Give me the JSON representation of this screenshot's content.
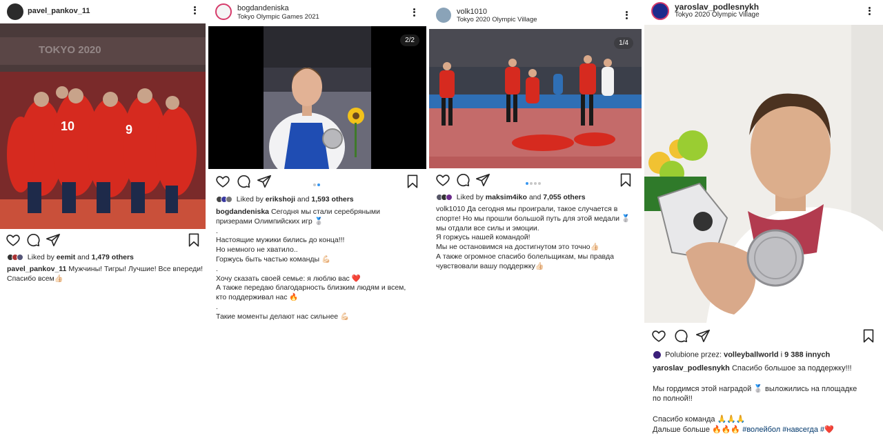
{
  "posts": [
    {
      "username": "pavel_pankov_11",
      "location": "",
      "photo": {
        "banner": "TOKYO 2020"
      },
      "liked_by": "eemit",
      "likes_count": "1,479 others",
      "caption_lines": [
        "Мужчины! Тигры! Лучшие! Все впереди!",
        "Спасибо всем👍🏻"
      ]
    },
    {
      "username": "bogdandeniska",
      "location": "Tokyo Olympic Games 2021",
      "counter": "2/2",
      "liked_by": "erikshoji",
      "likes_count": "1,593 others",
      "caption_lines": [
        "Сегодня мы стали серебряными",
        "призерами Олимпийских игр 🥈",
        ".",
        "Настоящие мужики бились до конца!!!",
        "Но немного не хватило..",
        "Горжусь быть частью команды 💪🏻",
        ".",
        "Хочу сказать своей семье: я люблю вас ❤️",
        "А также передаю благодарность близким людям и всем,",
        "кто поддерживал нас 🔥",
        ".",
        "Такие моменты делают нас сильнее 💪🏻"
      ]
    },
    {
      "username": "volk1010",
      "location": "Tokyo 2020 Olympic Village",
      "counter": "1/4",
      "liked_by": "maksim4iko",
      "likes_count": "7,055 others",
      "caption_lines": [
        "Да сегодня мы проиграли, такое случается в",
        "спорте! Но мы прошли большой путь для этой медали 🥈",
        "мы отдали все силы и эмоции.",
        "Я горжусь нашей командой!",
        "Мы не остановимся на достигнутом это точно👍🏻",
        "А также огромное спасибо болельщикам, мы правда",
        "чувствовали вашу поддержку👍🏻"
      ]
    },
    {
      "username": "yaroslav_podlesnykh",
      "location": "Tokyo 2020 Olympic Village",
      "liked_prefix": "Polubione przez:",
      "liked_by": "volleyballworld",
      "likes_joiner": "i",
      "likes_count": "9 388 innych",
      "caption_lines": [
        "Спасибо большое за поддержку!!!",
        "",
        "Мы гордимся этой наградой 🥈 выложились на площадке",
        "по полной!!",
        "",
        "Спасибо команда 🙏🙏🙏"
      ],
      "caption_last_prefix": "Дальше больше 🔥🔥🔥",
      "hashtags": [
        "#волейбол",
        "#навсегда",
        "#❤️"
      ]
    }
  ],
  "labels": {
    "liked_by_prefix": "Liked by",
    "and": "and"
  },
  "colors": {
    "jersey_red": "#d62a1f",
    "court_blue": "#2f6fb5",
    "link_blue": "#00376b",
    "dot_active": "#3897f0"
  },
  "icons": [
    "heart-icon",
    "comment-icon",
    "share-icon",
    "bookmark-icon",
    "more-icon"
  ]
}
